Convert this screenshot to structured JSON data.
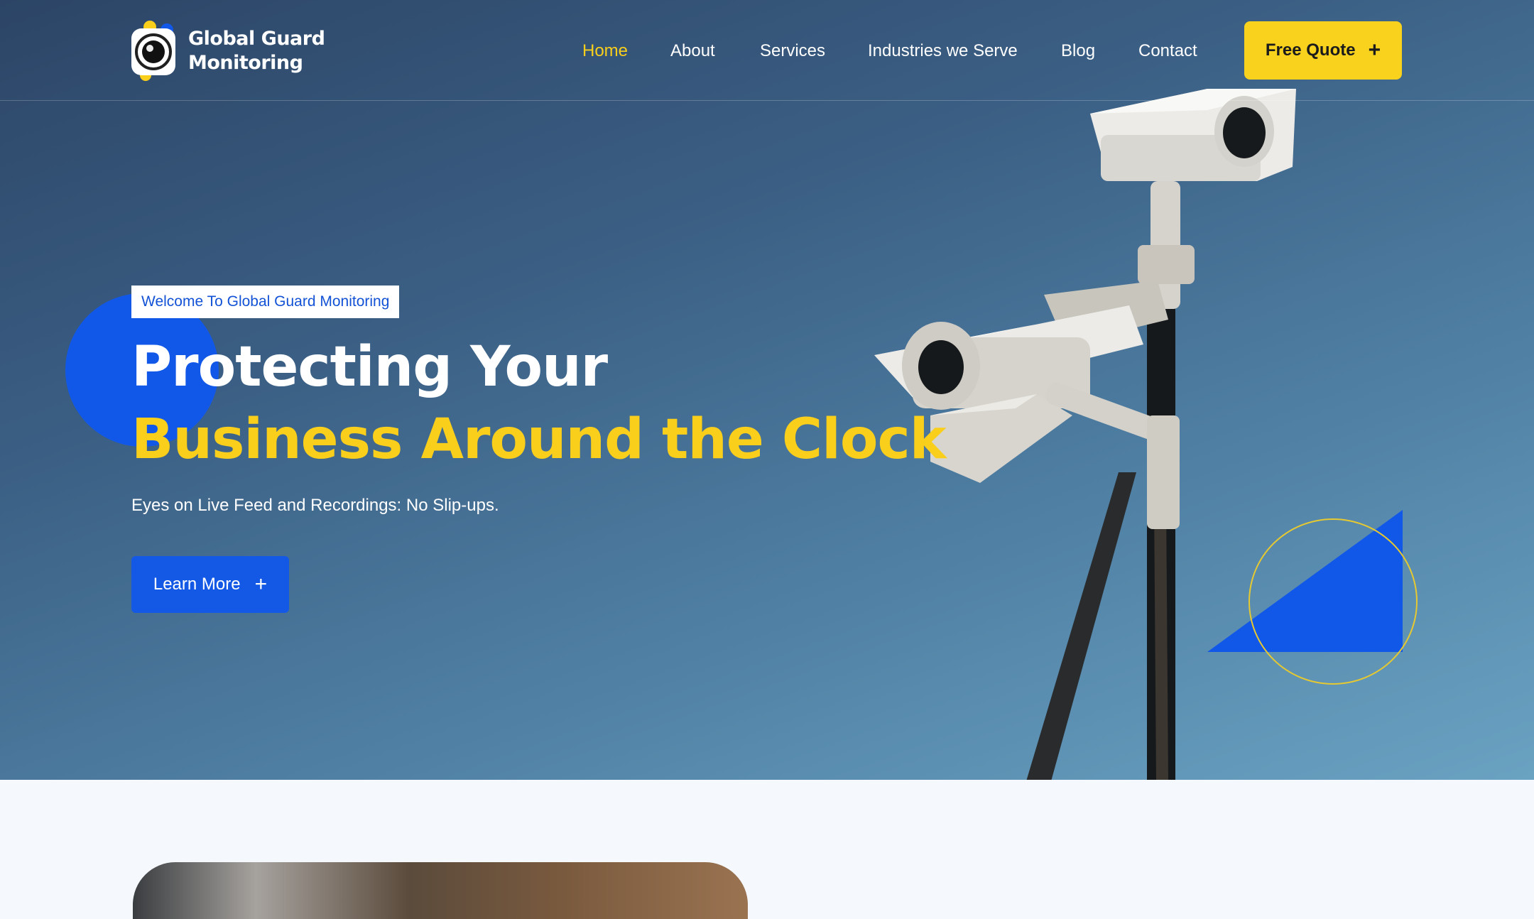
{
  "brand": {
    "name_line1": "Global Guard",
    "name_line2": "Monitoring",
    "logo_icon": "camera-lens-icon",
    "colors": {
      "accent_yellow": "#f9cf1c",
      "accent_blue": "#1258e8",
      "hero_dark": "#2c4566",
      "hero_light": "#6aa2c2"
    }
  },
  "nav": {
    "items": [
      {
        "label": "Home",
        "active": true
      },
      {
        "label": "About",
        "active": false
      },
      {
        "label": "Services",
        "active": false
      },
      {
        "label": "Industries we Serve",
        "active": false
      },
      {
        "label": "Blog",
        "active": false
      },
      {
        "label": "Contact",
        "active": false
      }
    ],
    "cta_label": "Free Quote",
    "cta_icon": "plus-icon"
  },
  "hero": {
    "badge": "Welcome To Global Guard Monitoring",
    "headline_line1": "Protecting Your",
    "headline_line2": "Business Around the Clock",
    "subtitle": "Eyes on Live Feed and Recordings: No Slip-ups.",
    "button_label": "Learn More",
    "button_icon": "plus-icon",
    "image": "security-cameras-on-pole"
  }
}
